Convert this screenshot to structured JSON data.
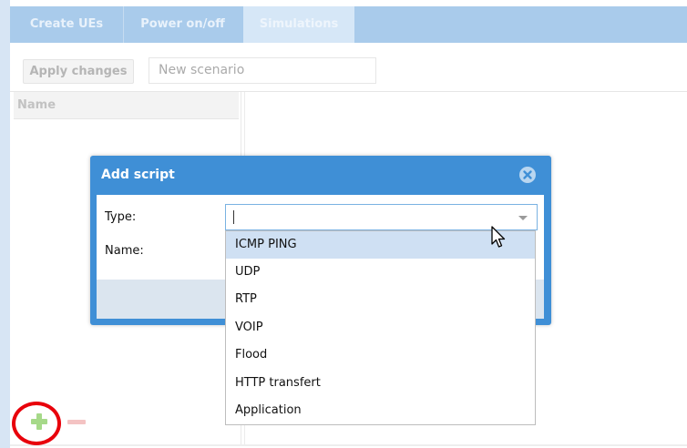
{
  "tabs": [
    {
      "label": "Create UEs"
    },
    {
      "label": "Power on/off"
    },
    {
      "label": "Simulations"
    }
  ],
  "toolbar": {
    "apply_label": "Apply changes",
    "scenario_value": "New scenario"
  },
  "grid": {
    "header_name": "Name"
  },
  "dialog": {
    "title": "Add script",
    "type_label": "Type:",
    "name_label": "Name:",
    "type_value": ""
  },
  "dropdown": {
    "options": [
      {
        "label": "ICMP PING",
        "highlighted": true
      },
      {
        "label": "UDP"
      },
      {
        "label": "RTP"
      },
      {
        "label": "VOIP"
      },
      {
        "label": "Flood"
      },
      {
        "label": "HTTP transfert"
      },
      {
        "label": "Application"
      }
    ]
  },
  "icons": {
    "add": "plus-icon",
    "remove": "minus-icon",
    "close": "close-circle-icon",
    "cursor": "mouse-pointer-icon"
  },
  "colors": {
    "accent": "#3f8fd6",
    "tab_bar": "#a9cbeb",
    "highlight_annotation": "#e8000b",
    "option_hover": "#cfe0f3"
  }
}
